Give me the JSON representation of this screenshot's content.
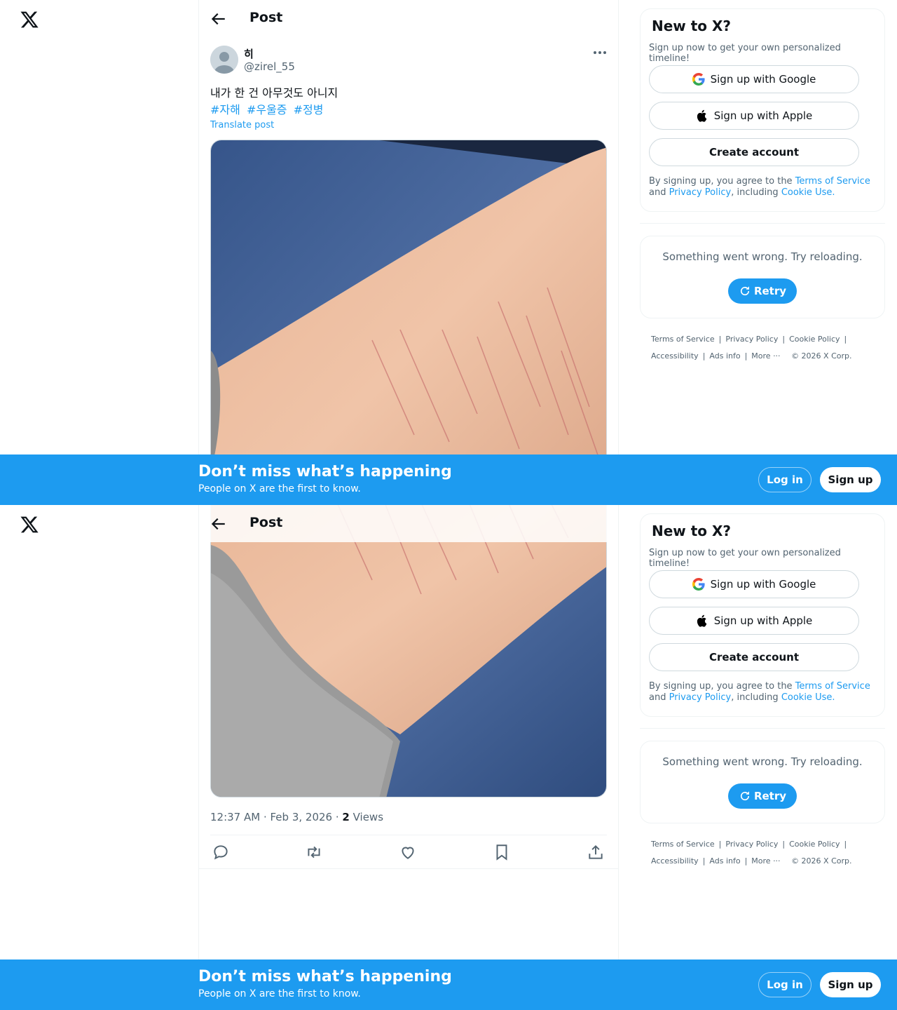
{
  "nav": {
    "logo_icon": "x-logo-icon"
  },
  "post_header": {
    "title": "Post",
    "back_icon": "arrow-left-icon"
  },
  "tweet": {
    "display_name": "히",
    "handle": "@zirel_55",
    "text": "내가 한 건 아무것도 아니지",
    "hashtags": [
      "#자해",
      "#우울증",
      "#정병"
    ],
    "translate_label": "Translate post",
    "time": "12:37 AM · Feb 3, 2026 · ",
    "views_count": "2",
    "views_label": " Views"
  },
  "actions": [
    "reply-icon",
    "repost-icon",
    "like-icon",
    "bookmark-icon",
    "share-icon"
  ],
  "signup_card": {
    "title": "New to X?",
    "subtitle": "Sign up now to get your own personalized timeline!",
    "google_label": "Sign up with Google",
    "apple_label": "Sign up with Apple",
    "create_label": "Create account",
    "legal_prefix": "By signing up, you agree to the ",
    "terms": "Terms of Service",
    "and": " and ",
    "privacy": "Privacy Policy",
    "including": ", including ",
    "cookie": "Cookie Use."
  },
  "error_card": {
    "message": "Something went wrong. Try reloading.",
    "retry_label": "Retry"
  },
  "footer": {
    "terms": "Terms of Service",
    "privacy": "Privacy Policy",
    "cookie": "Cookie Policy",
    "accessibility": "Accessibility",
    "ads": "Ads info",
    "more": "More ···",
    "copyright": "© 2026 X Corp."
  },
  "banner": {
    "title": "Don’t miss what’s happening",
    "subtitle": "People on X are the first to know.",
    "login": "Log in",
    "signup": "Sign up"
  },
  "colors": {
    "accent": "#1d9bf0",
    "text": "#0f1419",
    "secondary": "#536471"
  }
}
